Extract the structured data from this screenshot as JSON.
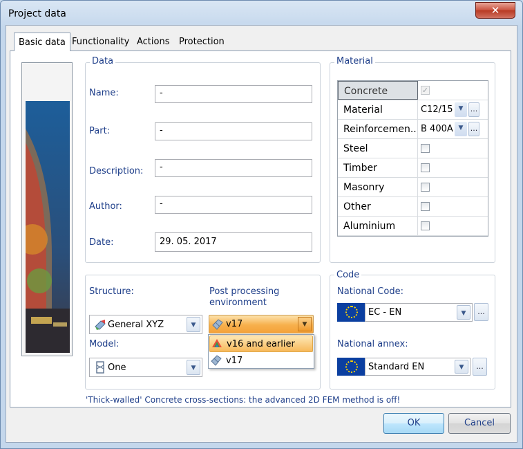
{
  "window": {
    "title": "Project data",
    "close_symbol": "✕"
  },
  "tabs": [
    "Basic data",
    "Functionality",
    "Actions",
    "Protection"
  ],
  "data_group": {
    "title": "Data",
    "fields": [
      {
        "label": "Name:",
        "value": "-"
      },
      {
        "label": "Part:",
        "value": "-"
      },
      {
        "label": "Description:",
        "value": "-"
      },
      {
        "label": "Author:",
        "value": "-"
      },
      {
        "label": "Date:",
        "value": "29. 05. 2017"
      }
    ]
  },
  "material_group": {
    "title": "Material",
    "rows": [
      {
        "name": "Concrete",
        "type": "check",
        "checked": true,
        "disabled": true
      },
      {
        "name": "Material",
        "type": "combo",
        "value": "C12/15"
      },
      {
        "name": "Reinforcemen...",
        "type": "combo",
        "value": "B 400A"
      },
      {
        "name": "Steel",
        "type": "check",
        "checked": false
      },
      {
        "name": "Timber",
        "type": "check",
        "checked": false
      },
      {
        "name": "Masonry",
        "type": "check",
        "checked": false
      },
      {
        "name": "Other",
        "type": "check",
        "checked": false
      },
      {
        "name": "Aluminium",
        "type": "check",
        "checked": false
      }
    ],
    "dots": "..."
  },
  "settings": {
    "structure_label": "Structure:",
    "structure_value": "General XYZ",
    "postproc_label": "Post processing environment",
    "postproc_value": "v17",
    "model_label": "Model:",
    "model_value": "One",
    "dropdown_options": [
      "v16 and earlier",
      "v17"
    ]
  },
  "code_group": {
    "title": "Code",
    "national_code_label": "National Code:",
    "national_code_value": "EC - EN",
    "national_annex_label": "National annex:",
    "national_annex_value": "Standard EN",
    "dots": "..."
  },
  "status_message": "'Thick-walled' Concrete cross-sections: the advanced 2D FEM method is off!",
  "buttons": {
    "ok": "OK",
    "cancel": "Cancel"
  },
  "colors": {
    "label_blue": "#1f3f8a",
    "eu_blue": "#0b3fa0",
    "eu_gold": "#ffd400",
    "highlight_orange": "#f7b04c"
  }
}
